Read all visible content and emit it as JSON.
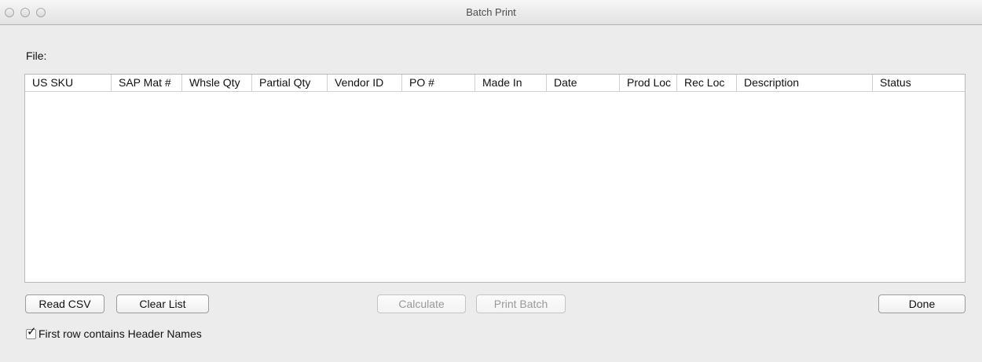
{
  "window": {
    "title": "Batch Print"
  },
  "file": {
    "label": "File:"
  },
  "table": {
    "columns": [
      "US SKU",
      "SAP Mat #",
      "Whsle Qty",
      "Partial Qty",
      "Vendor ID",
      "PO #",
      "Made In",
      "Date",
      "Prod Loc",
      "Rec Loc",
      "Description",
      "Status"
    ],
    "rows": []
  },
  "buttons": {
    "read_csv": "Read CSV",
    "clear_list": "Clear List",
    "calculate": "Calculate",
    "print_batch": "Print Batch",
    "done": "Done"
  },
  "options": {
    "header_row_label": "First row contains Header Names",
    "header_row_checked": true
  },
  "icons": {
    "checkbox": "checkmark-icon",
    "window_controls": [
      "close-icon",
      "minimize-icon",
      "zoom-icon"
    ]
  }
}
